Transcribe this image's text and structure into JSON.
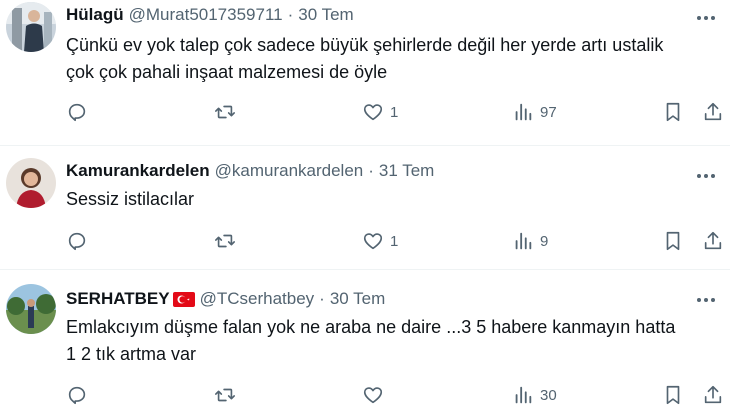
{
  "tweets": [
    {
      "name": "Hülagü",
      "handle": "@Murat5017359711",
      "separator": "·",
      "date": "30 Tem",
      "text_lines": [
        "Çünkü ev yok talep çok sadece büyük şehirlerde değil her yerde artı ustalik",
        "çok çok pahali inşaat malzemesi de öyle"
      ],
      "likes": "1",
      "views": "97",
      "flag": false
    },
    {
      "name": "Kamurankardelen",
      "handle": "@kamurankardelen",
      "separator": "·",
      "date": "31 Tem",
      "text_lines": [
        "Sessiz istilacılar"
      ],
      "likes": "1",
      "views": "9",
      "flag": false
    },
    {
      "name": "SERHATBEY",
      "handle": "@TCserhatbey",
      "separator": "·",
      "date": "30 Tem",
      "text_lines": [
        "Emlakcıyım düşme falan yok ne araba ne daire ...3 5 habere kanmayın hatta",
        "1 2 tık artma var"
      ],
      "likes": "",
      "views": "30",
      "flag": true
    }
  ],
  "icons": {
    "more": "more-horizontal-icon",
    "reply": "reply-icon",
    "retweet": "retweet-icon",
    "like": "heart-icon",
    "views": "views-icon",
    "bookmark": "bookmark-icon",
    "share": "share-icon"
  },
  "colors": {
    "text": "#0f1419",
    "secondary": "#536471",
    "divider": "#eff3f4",
    "flag_red": "#e30a17"
  }
}
